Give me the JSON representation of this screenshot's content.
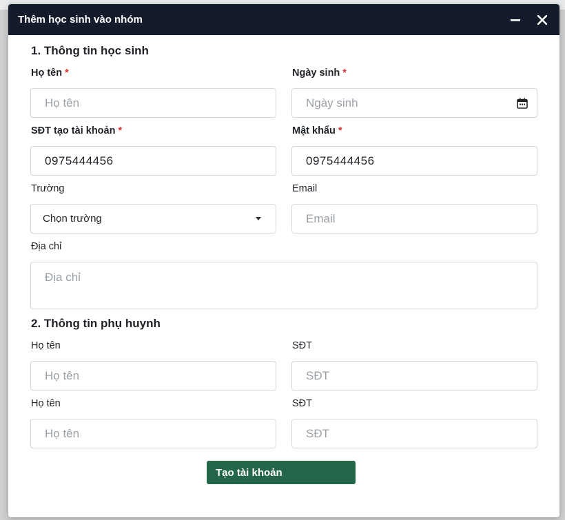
{
  "modal": {
    "title": "Thêm học sinh vào nhóm",
    "minimize_icon": "minus-icon",
    "close_icon": "close-icon"
  },
  "student_section": {
    "title": "1. Thông tin học sinh",
    "name": {
      "label": "Họ tên",
      "placeholder": "Họ tên",
      "required": true
    },
    "birthday": {
      "label": "Ngày sinh",
      "placeholder": "Ngày sinh",
      "required": true,
      "icon": "calendar-icon"
    },
    "phone": {
      "label": "SĐT tạo tài khoản",
      "value": "0975444456",
      "required": true
    },
    "password": {
      "label": "Mật khẩu",
      "value": "0975444456",
      "required": true
    },
    "school": {
      "label": "Trường",
      "selected": "Chọn trường",
      "icon": "caret-down-icon"
    },
    "email": {
      "label": "Email",
      "placeholder": "Email"
    },
    "address": {
      "label": "Địa chỉ",
      "placeholder": "Địa chỉ"
    },
    "required_mark": "*"
  },
  "parent_section": {
    "title": "2. Thông tin phụ huynh",
    "parents": [
      {
        "name_label": "Họ tên",
        "name_placeholder": "Họ tên",
        "phone_label": "SĐT",
        "phone_placeholder": "SĐT"
      },
      {
        "name_label": "Họ tên",
        "name_placeholder": "Họ tên",
        "phone_label": "SĐT",
        "phone_placeholder": "SĐT"
      }
    ]
  },
  "submit_label": "Tạo tài khoản",
  "colors": {
    "header_bg": "#141b2b",
    "submit_bg": "#23664a",
    "required": "#e03131"
  }
}
